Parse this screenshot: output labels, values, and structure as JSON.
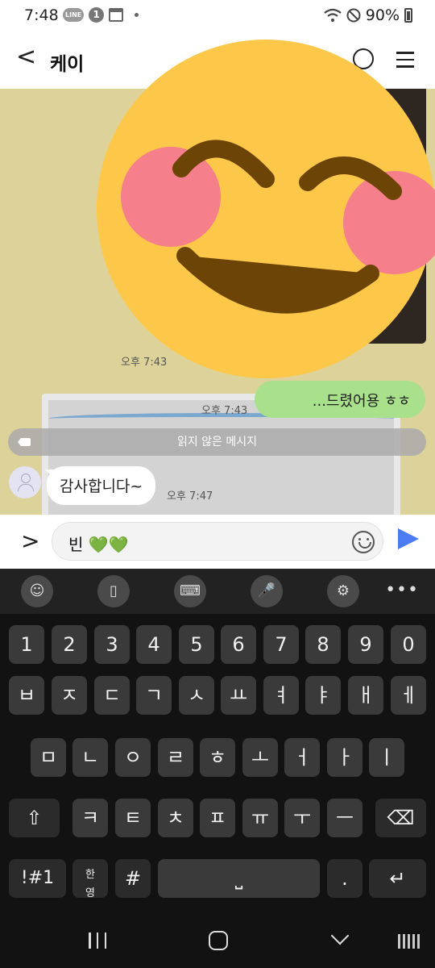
{
  "status_bar": {
    "time": "7:48",
    "line_badge": "LINE",
    "one_badge": "1",
    "battery": "90%"
  },
  "header": {
    "back_glyph": "<",
    "title": "케이"
  },
  "chat": {
    "messages": [
      {
        "side": "out",
        "time": "오후 7:43",
        "text": "오늘 잘 먹었어용 ㅎㅎ",
        "visible_text": "...드렸어용 ㅎㅎ"
      },
      {
        "side": "in",
        "time": "오후 7:47",
        "text": "감사합니다~"
      }
    ],
    "sticker_time": "오후 7:43",
    "unread_divider": "읽지 않은 메시지"
  },
  "composer": {
    "expand_glyph": ">",
    "text": "빈 💚💚"
  },
  "keyboard": {
    "toolbar": [
      "emoji-icon",
      "clipboard-icon",
      "keyboard-mode-icon",
      "mic-icon",
      "settings-icon",
      "more-icon"
    ],
    "more_glyph": "•••",
    "row_numbers": [
      "1",
      "2",
      "3",
      "4",
      "5",
      "6",
      "7",
      "8",
      "9",
      "0"
    ],
    "row1": [
      "ㅂ",
      "ㅈ",
      "ㄷ",
      "ㄱ",
      "ㅅ",
      "ㅛ",
      "ㅕ",
      "ㅑ",
      "ㅐ",
      "ㅔ"
    ],
    "row2": [
      "ㅁ",
      "ㄴ",
      "ㅇ",
      "ㄹ",
      "ㅎ",
      "ㅗ",
      "ㅓ",
      "ㅏ",
      "ㅣ"
    ],
    "row3": [
      "ㅋ",
      "ㅌ",
      "ㅊ",
      "ㅍ",
      "ㅠ",
      "ㅜ",
      "ㅡ"
    ],
    "shift_glyph": "⇧",
    "backspace_glyph": "⌫",
    "symbols_label": "!#1",
    "lang_top": "한",
    "lang_bottom": "영",
    "hash_label": "#",
    "space_glyph": "⎵",
    "period_label": ".",
    "enter_glyph": "↵"
  },
  "colors": {
    "chat_bg": "#ddd29a",
    "outgoing_bubble": "#a8e08b",
    "send_button": "#4d7cf2",
    "keyboard_bg": "#121212"
  }
}
